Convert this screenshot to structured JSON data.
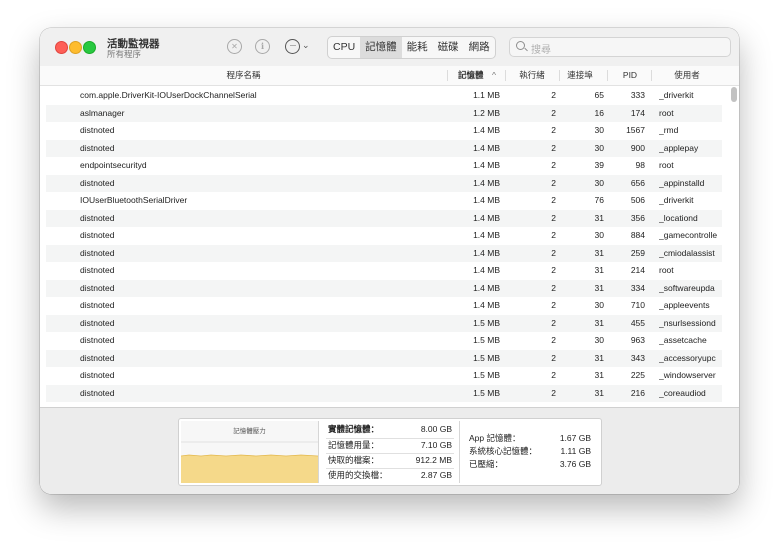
{
  "window": {
    "title": "活動監視器",
    "subtitle": "所有程序"
  },
  "toolbar": {
    "stop_icon": "x-circle-icon",
    "info_icon": "info-circle-icon",
    "more_icon": "ellipsis-circle-icon",
    "tabs": [
      {
        "label": "CPU",
        "active": false
      },
      {
        "label": "記憶體",
        "active": true
      },
      {
        "label": "能耗",
        "active": false
      },
      {
        "label": "磁碟",
        "active": false
      },
      {
        "label": "網路",
        "active": false
      }
    ],
    "search_placeholder": "搜尋"
  },
  "table": {
    "headers": {
      "name": "程序名稱",
      "memory": "記憶體",
      "threads": "執行緒",
      "ports": "連接埠",
      "pid": "PID",
      "user": "使用者"
    },
    "sort_indicator": "^",
    "rows": [
      {
        "name": "com.apple.DriverKit-IOUserDockChannelSerial",
        "memory": "1.1 MB",
        "threads": "2",
        "ports": "65",
        "pid": "333",
        "user": "_driverkit"
      },
      {
        "name": "aslmanager",
        "memory": "1.2 MB",
        "threads": "2",
        "ports": "16",
        "pid": "174",
        "user": "root"
      },
      {
        "name": "distnoted",
        "memory": "1.4 MB",
        "threads": "2",
        "ports": "30",
        "pid": "1567",
        "user": "_rmd"
      },
      {
        "name": "distnoted",
        "memory": "1.4 MB",
        "threads": "2",
        "ports": "30",
        "pid": "900",
        "user": "_applepay"
      },
      {
        "name": "endpointsecurityd",
        "memory": "1.4 MB",
        "threads": "2",
        "ports": "39",
        "pid": "98",
        "user": "root"
      },
      {
        "name": "distnoted",
        "memory": "1.4 MB",
        "threads": "2",
        "ports": "30",
        "pid": "656",
        "user": "_appinstalld"
      },
      {
        "name": "IOUserBluetoothSerialDriver",
        "memory": "1.4 MB",
        "threads": "2",
        "ports": "76",
        "pid": "506",
        "user": "_driverkit"
      },
      {
        "name": "distnoted",
        "memory": "1.4 MB",
        "threads": "2",
        "ports": "31",
        "pid": "356",
        "user": "_locationd"
      },
      {
        "name": "distnoted",
        "memory": "1.4 MB",
        "threads": "2",
        "ports": "30",
        "pid": "884",
        "user": "_gamecontrolle"
      },
      {
        "name": "distnoted",
        "memory": "1.4 MB",
        "threads": "2",
        "ports": "31",
        "pid": "259",
        "user": "_cmiodalassist"
      },
      {
        "name": "distnoted",
        "memory": "1.4 MB",
        "threads": "2",
        "ports": "31",
        "pid": "214",
        "user": "root"
      },
      {
        "name": "distnoted",
        "memory": "1.4 MB",
        "threads": "2",
        "ports": "31",
        "pid": "334",
        "user": "_softwareupda"
      },
      {
        "name": "distnoted",
        "memory": "1.4 MB",
        "threads": "2",
        "ports": "30",
        "pid": "710",
        "user": "_appleevents"
      },
      {
        "name": "distnoted",
        "memory": "1.5 MB",
        "threads": "2",
        "ports": "31",
        "pid": "455",
        "user": "_nsurlsessiond"
      },
      {
        "name": "distnoted",
        "memory": "1.5 MB",
        "threads": "2",
        "ports": "30",
        "pid": "963",
        "user": "_assetcache"
      },
      {
        "name": "distnoted",
        "memory": "1.5 MB",
        "threads": "2",
        "ports": "31",
        "pid": "343",
        "user": "_accessoryupc"
      },
      {
        "name": "distnoted",
        "memory": "1.5 MB",
        "threads": "2",
        "ports": "31",
        "pid": "225",
        "user": "_windowserver"
      },
      {
        "name": "distnoted",
        "memory": "1.5 MB",
        "threads": "2",
        "ports": "31",
        "pid": "216",
        "user": "_coreaudiod"
      }
    ]
  },
  "summary": {
    "pressure_label": "記憶體壓力",
    "pressure_color": "#f5d98a",
    "physical_label": "實體記憶體：",
    "physical_value": "8.00 GB",
    "used_label": "記憶體用量：",
    "used_value": "7.10 GB",
    "cached_label": "快取的檔案：",
    "cached_value": "912.2 MB",
    "swap_label": "使用的交換檔：",
    "swap_value": "2.87 GB",
    "app_label": "App 記憶體：",
    "app_value": "1.67 GB",
    "wired_label": "系統核心記憶體：",
    "wired_value": "1.11 GB",
    "compressed_label": "已壓縮：",
    "compressed_value": "3.76 GB"
  }
}
